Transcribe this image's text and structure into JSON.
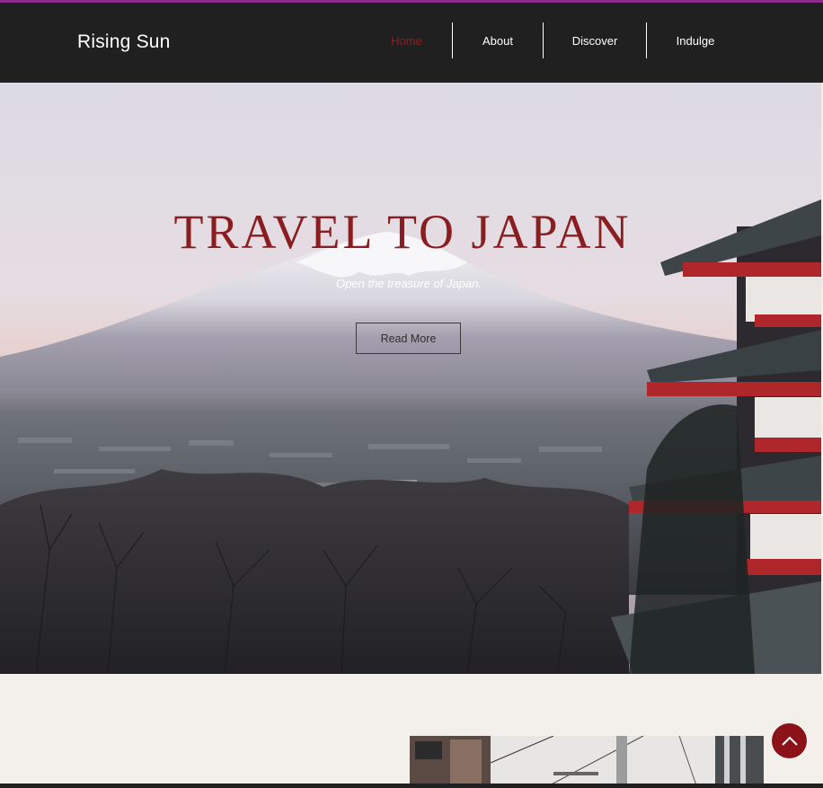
{
  "site": {
    "brand": "Rising Sun"
  },
  "nav": {
    "items": [
      {
        "label": "Home",
        "active": true
      },
      {
        "label": "About",
        "active": false
      },
      {
        "label": "Discover",
        "active": false
      },
      {
        "label": "Indulge",
        "active": false
      }
    ]
  },
  "hero": {
    "title": "TRAVEL TO JAPAN",
    "subtitle": "Open the treasure of Japan.",
    "button_label": "Read More",
    "image": "mount-fuji-pagoda-photo"
  },
  "scroll_top": {
    "icon": "chevron-up-icon"
  },
  "colors": {
    "header_bg": "#202020",
    "accent_red": "#8a1d1f",
    "active_nav": "#9b1b1b",
    "page_bg": "#f3f0ec",
    "top_stripe": "#8e2b8a"
  }
}
